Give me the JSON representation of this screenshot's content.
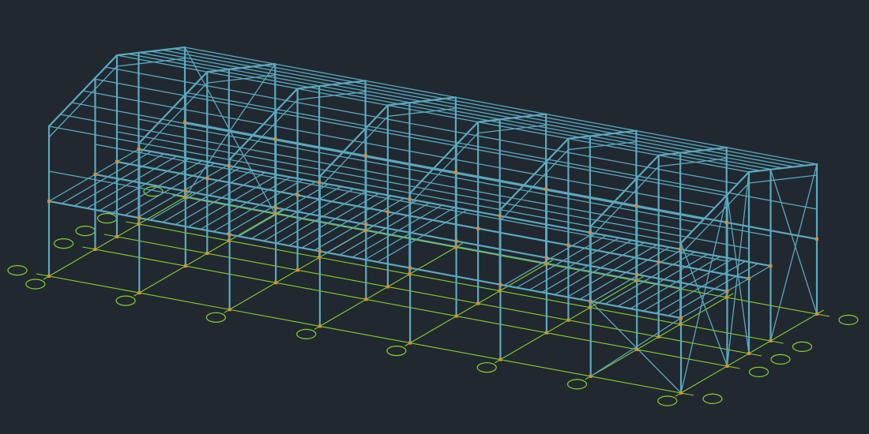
{
  "viewport": {
    "background_color": "#212830",
    "steel_color": "#5aa9bf",
    "grid_color": "#86d32a",
    "node_color": "#e08b32"
  }
}
